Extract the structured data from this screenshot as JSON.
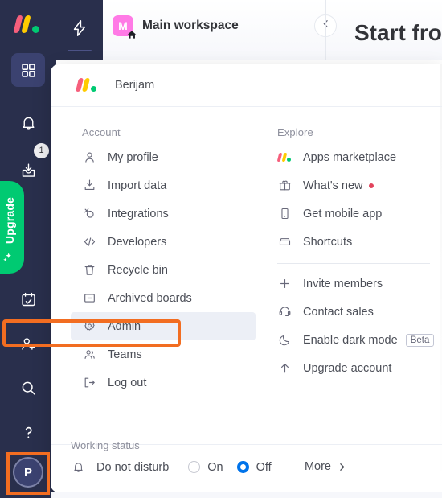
{
  "app": {
    "name": "monday.com",
    "logo_icon": "monday-logo-icon",
    "accent_orange": "#f26d21",
    "accent_blue": "#0073ea",
    "rail_bg": "#292f4c",
    "upgrade_green": "#00ca72"
  },
  "rail": {
    "logo_name": "monday-logo-icon",
    "items": [
      {
        "name": "home-grid-icon",
        "label": "Home",
        "active": true
      },
      {
        "name": "bell-icon",
        "label": "Notifications",
        "active": false
      },
      {
        "name": "inbox-download-icon",
        "label": "Inbox",
        "active": false,
        "badge": "1"
      },
      {
        "name": "calendar-check-icon",
        "label": "My work",
        "active": false
      },
      {
        "name": "invite-person-icon",
        "label": "Invite members",
        "active": false
      },
      {
        "name": "search-icon",
        "label": "Search",
        "active": false
      },
      {
        "name": "question-mark-icon",
        "label": "Help",
        "active": false
      }
    ],
    "badge_count": "1",
    "upgrade_label": "Upgrade",
    "upgrade_icon": "sparkle-icon",
    "avatar_initial": "P",
    "bolt_icon": "lightning-bolt-icon"
  },
  "board_header": {
    "workspace_initial": "M",
    "workspace_title": "Main workspace",
    "home_icon": "home-icon",
    "collapse_icon": "chevron-left-icon",
    "page_heading": "Start fro"
  },
  "panel": {
    "account_name": "Berijam",
    "logo_icon": "monday-logo-icon",
    "left_column": {
      "title": "Account",
      "items": [
        {
          "label": "My profile",
          "icon": "person-icon",
          "highlighted": false
        },
        {
          "label": "Import data",
          "icon": "import-icon",
          "highlighted": false
        },
        {
          "label": "Integrations",
          "icon": "integrations-icon",
          "highlighted": false
        },
        {
          "label": "Developers",
          "icon": "code-brackets-icon",
          "highlighted": false
        },
        {
          "label": "Recycle bin",
          "icon": "trash-icon",
          "highlighted": false
        },
        {
          "label": "Archived boards",
          "icon": "archive-box-icon",
          "highlighted": false
        },
        {
          "label": "Admin",
          "icon": "gear-icon",
          "highlighted": true
        },
        {
          "label": "Teams",
          "icon": "people-icon",
          "highlighted": false
        },
        {
          "label": "Log out",
          "icon": "logout-icon",
          "highlighted": false
        }
      ]
    },
    "right_column": {
      "title": "Explore",
      "items_top": [
        {
          "label": "Apps marketplace",
          "icon": "monday-apps-icon"
        },
        {
          "label": "What's new",
          "icon": "gift-icon",
          "dot": true
        },
        {
          "label": "Get mobile app",
          "icon": "mobile-phone-icon"
        },
        {
          "label": "Shortcuts",
          "icon": "keyboard-icon"
        }
      ],
      "items_bottom": [
        {
          "label": "Invite members",
          "icon": "plus-icon"
        },
        {
          "label": "Contact sales",
          "icon": "headset-icon"
        },
        {
          "label": "Enable dark mode",
          "icon": "moon-icon",
          "badge": "Beta"
        },
        {
          "label": "Upgrade account",
          "icon": "arrow-up-icon"
        }
      ]
    },
    "footer": {
      "title": "Working status",
      "icon": "bell-icon",
      "label": "Do not disturb",
      "options": [
        {
          "label": "On",
          "selected": false
        },
        {
          "label": "Off",
          "selected": true
        }
      ],
      "more_label": "More",
      "more_icon": "chevron-right-icon"
    }
  }
}
